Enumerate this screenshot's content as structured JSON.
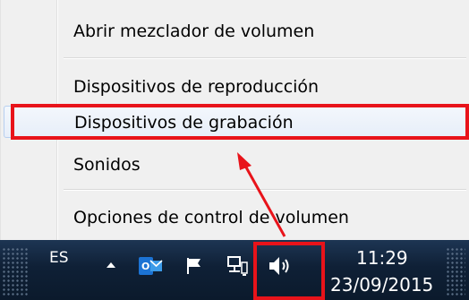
{
  "context_menu": {
    "items": [
      {
        "label": "Abrir mezclador de volumen"
      },
      {
        "label": "Dispositivos de reproducción"
      },
      {
        "label": "Dispositivos de grabación",
        "highlighted": true
      },
      {
        "label": "Sonidos"
      },
      {
        "label": "Opciones de control de volumen"
      }
    ]
  },
  "taskbar": {
    "language": "ES",
    "tray_icons": [
      "chevron-up-icon",
      "outlook-icon",
      "flag-icon",
      "network-icon",
      "speaker-icon"
    ],
    "clock": {
      "time": "11:29",
      "date": "23/09/2015"
    }
  },
  "annotation": {
    "color": "#e8131a"
  }
}
